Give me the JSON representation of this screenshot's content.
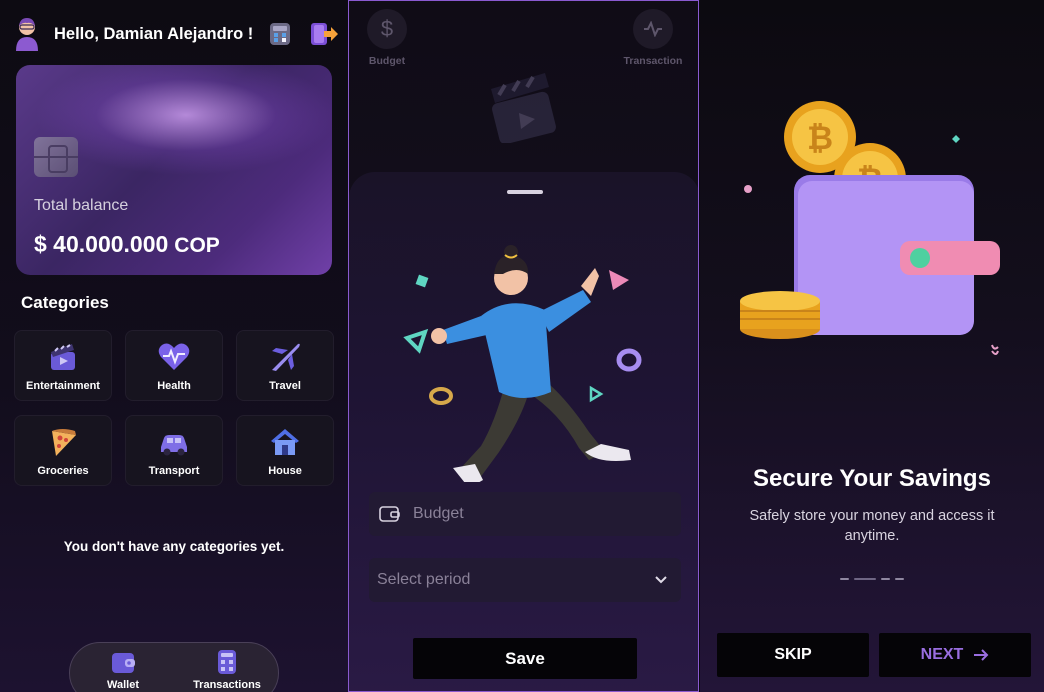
{
  "colors": {
    "accent": "#9a6ee0",
    "panel_border": "#8a5ad0",
    "card_purple": "#4d2b7c"
  },
  "home": {
    "greeting": "Hello, Damian Alejandro !",
    "header_icons": [
      "calculator-icon",
      "logout-icon"
    ],
    "card": {
      "balance_label": "Total balance",
      "balance_amount": "$ 40.000.000",
      "currency": "COP"
    },
    "categories_title": "Categories",
    "categories": [
      {
        "label": "Entertainment",
        "icon": "clapperboard-icon"
      },
      {
        "label": "Health",
        "icon": "heart-pulse-icon"
      },
      {
        "label": "Travel",
        "icon": "airplane-icon"
      },
      {
        "label": "Groceries",
        "icon": "pizza-icon"
      },
      {
        "label": "Transport",
        "icon": "car-icon"
      },
      {
        "label": "House",
        "icon": "house-icon"
      }
    ],
    "empty_message": "You don't have any categories yet.",
    "nav": {
      "wallet_label": "Wallet",
      "transactions_label": "Transactions"
    }
  },
  "budget": {
    "bg_tabs": {
      "budget_label": "Budget",
      "transaction_label": "Transaction"
    },
    "budget_placeholder": "Budget",
    "period_placeholder": "Select period",
    "save_label": "Save"
  },
  "onboarding": {
    "title": "Secure Your Savings",
    "subtitle": "Safely store your money and access it anytime.",
    "page_index": 2,
    "page_count": 4,
    "skip_label": "SKIP",
    "next_label": "NEXT"
  }
}
